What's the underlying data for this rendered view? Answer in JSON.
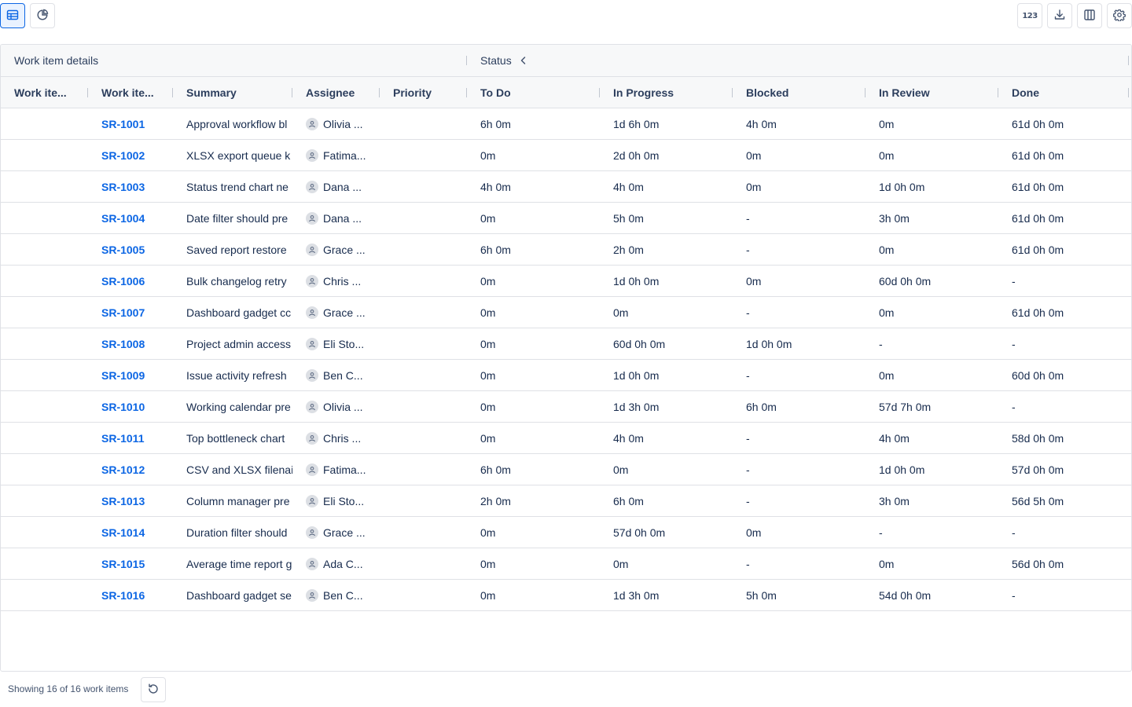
{
  "toolbar": {
    "left_buttons": [
      {
        "name": "table-view",
        "icon": "table-icon",
        "active": true
      },
      {
        "name": "chart-view",
        "icon": "pie-chart-icon",
        "active": false
      }
    ],
    "right_buttons": [
      {
        "name": "number-format",
        "icon": "number-format-icon",
        "label": "123"
      },
      {
        "name": "export",
        "icon": "download-icon"
      },
      {
        "name": "columns",
        "icon": "columns-icon"
      },
      {
        "name": "settings",
        "icon": "gear-icon"
      }
    ]
  },
  "grid": {
    "groups": {
      "details": "Work item details",
      "status": "Status"
    },
    "columns": {
      "type": "Work ite...",
      "key": "Work ite...",
      "summary": "Summary",
      "assignee": "Assignee",
      "priority": "Priority",
      "todo": "To Do",
      "inprogress": "In Progress",
      "blocked": "Blocked",
      "inreview": "In Review",
      "done": "Done"
    },
    "rows": [
      {
        "key": "SR-1001",
        "summary": "Approval workflow bl",
        "assignee": "Olivia ...",
        "todo": "6h 0m",
        "inprogress": "1d 6h 0m",
        "blocked": "4h 0m",
        "inreview": "0m",
        "done": "61d 0h 0m"
      },
      {
        "key": "SR-1002",
        "summary": "XLSX export queue k",
        "assignee": "Fatima...",
        "todo": "0m",
        "inprogress": "2d 0h 0m",
        "blocked": "0m",
        "inreview": "0m",
        "done": "61d 0h 0m"
      },
      {
        "key": "SR-1003",
        "summary": "Status trend chart ne",
        "assignee": "Dana ...",
        "todo": "4h 0m",
        "inprogress": "4h 0m",
        "blocked": "0m",
        "inreview": "1d 0h 0m",
        "done": "61d 0h 0m"
      },
      {
        "key": "SR-1004",
        "summary": "Date filter should pre",
        "assignee": "Dana ...",
        "todo": "0m",
        "inprogress": "5h 0m",
        "blocked": "-",
        "inreview": "3h 0m",
        "done": "61d 0h 0m"
      },
      {
        "key": "SR-1005",
        "summary": "Saved report restore",
        "assignee": "Grace ...",
        "todo": "6h 0m",
        "inprogress": "2h 0m",
        "blocked": "-",
        "inreview": "0m",
        "done": "61d 0h 0m"
      },
      {
        "key": "SR-1006",
        "summary": "Bulk changelog retry",
        "assignee": "Chris ...",
        "todo": "0m",
        "inprogress": "1d 0h 0m",
        "blocked": "0m",
        "inreview": "60d 0h 0m",
        "done": "-"
      },
      {
        "key": "SR-1007",
        "summary": "Dashboard gadget cc",
        "assignee": "Grace ...",
        "todo": "0m",
        "inprogress": "0m",
        "blocked": "-",
        "inreview": "0m",
        "done": "61d 0h 0m"
      },
      {
        "key": "SR-1008",
        "summary": "Project admin access",
        "assignee": "Eli Sto...",
        "todo": "0m",
        "inprogress": "60d 0h 0m",
        "blocked": "1d 0h 0m",
        "inreview": "-",
        "done": "-"
      },
      {
        "key": "SR-1009",
        "summary": "Issue activity refresh",
        "assignee": "Ben C...",
        "todo": "0m",
        "inprogress": "1d 0h 0m",
        "blocked": "-",
        "inreview": "0m",
        "done": "60d 0h 0m"
      },
      {
        "key": "SR-1010",
        "summary": "Working calendar pre",
        "assignee": "Olivia ...",
        "todo": "0m",
        "inprogress": "1d 3h 0m",
        "blocked": "6h 0m",
        "inreview": "57d 7h 0m",
        "done": "-"
      },
      {
        "key": "SR-1011",
        "summary": "Top bottleneck chart",
        "assignee": "Chris ...",
        "todo": "0m",
        "inprogress": "4h 0m",
        "blocked": "-",
        "inreview": "4h 0m",
        "done": "58d 0h 0m"
      },
      {
        "key": "SR-1012",
        "summary": "CSV and XLSX filenai",
        "assignee": "Fatima...",
        "todo": "6h 0m",
        "inprogress": "0m",
        "blocked": "-",
        "inreview": "1d 0h 0m",
        "done": "57d 0h 0m"
      },
      {
        "key": "SR-1013",
        "summary": "Column manager pre",
        "assignee": "Eli Sto...",
        "todo": "2h 0m",
        "inprogress": "6h 0m",
        "blocked": "-",
        "inreview": "3h 0m",
        "done": "56d 5h 0m"
      },
      {
        "key": "SR-1014",
        "summary": "Duration filter should",
        "assignee": "Grace ...",
        "todo": "0m",
        "inprogress": "57d 0h 0m",
        "blocked": "0m",
        "inreview": "-",
        "done": "-"
      },
      {
        "key": "SR-1015",
        "summary": "Average time report g",
        "assignee": "Ada C...",
        "todo": "0m",
        "inprogress": "0m",
        "blocked": "-",
        "inreview": "0m",
        "done": "56d 0h 0m"
      },
      {
        "key": "SR-1016",
        "summary": "Dashboard gadget se",
        "assignee": "Ben C...",
        "todo": "0m",
        "inprogress": "1d 3h 0m",
        "blocked": "5h 0m",
        "inreview": "54d 0h 0m",
        "done": "-"
      }
    ]
  },
  "footer": {
    "count_text": "Showing 16 of 16 work items",
    "reset_icon": "reset-icon"
  },
  "colors": {
    "link": "#0c66e4",
    "header_bg": "#f7f8f9",
    "border": "#dfe1e6",
    "active_bg": "#e9f2ff"
  }
}
